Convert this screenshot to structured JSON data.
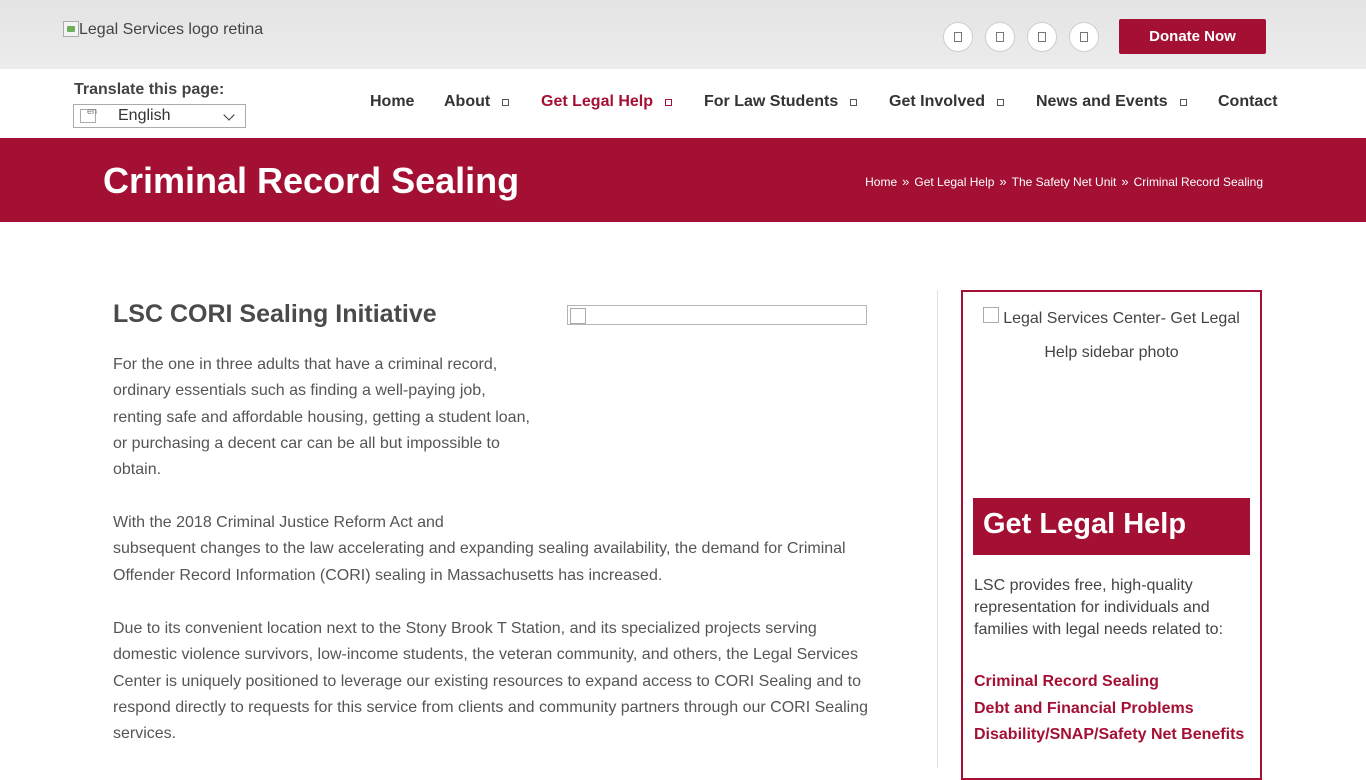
{
  "header": {
    "logo_alt": "Legal Services logo retina",
    "social_icons": [
      "facebook-icon",
      "twitter-icon",
      "instagram-icon",
      "youtube-icon"
    ],
    "donate_label": "Donate Now"
  },
  "translate": {
    "label": "Translate this page:",
    "flag_code": "en",
    "selected": "English"
  },
  "nav": {
    "items": [
      {
        "label": "Home",
        "has_dropdown": false,
        "active": false
      },
      {
        "label": "About",
        "has_dropdown": true,
        "active": false
      },
      {
        "label": "Get Legal Help",
        "has_dropdown": true,
        "active": true
      },
      {
        "label": "For Law Students",
        "has_dropdown": true,
        "active": false
      },
      {
        "label": "Get Involved",
        "has_dropdown": true,
        "active": false
      },
      {
        "label": "News and Events",
        "has_dropdown": true,
        "active": false
      },
      {
        "label": "Contact",
        "has_dropdown": false,
        "active": false
      }
    ]
  },
  "banner": {
    "title": "Criminal Record Sealing",
    "breadcrumb": [
      "Home",
      "Get Legal Help",
      "The Safety Net Unit",
      "Criminal Record Sealing"
    ],
    "separator": "»"
  },
  "main": {
    "heading": "LSC CORI Sealing Initiative",
    "paragraph1": "For the one in three adults that have a criminal record, ordinary essentials such as finding a well-paying job, renting safe and affordable housing, getting a student loan, or purchasing a decent car can be all but impossible to obtain.",
    "paragraph2_line1": "With the 2018 Criminal Justice Reform Act  and",
    "paragraph2_rest": "subsequent changes to the law accelerating and expanding sealing availability, the demand for Criminal Offender Record Information (CORI) sealing in Massachusetts has increased.",
    "paragraph3": "Due to its convenient location next to the Stony Brook T Station, and its specialized projects serving domestic violence survivors, low-income students, the veteran community, and others, the Legal Services Center is uniquely positioned to leverage our existing resources to expand access to CORI Sealing and to respond directly to requests for this service from clients and community partners through our CORI Sealing services."
  },
  "sidebar": {
    "photo_alt": "Legal Services Center- Get Legal Help sidebar photo",
    "heading": "Get Legal Help",
    "description": "LSC provides free, high-quality representation for individuals and families with legal needs related to:",
    "links": [
      "Criminal Record Sealing",
      "Debt and Financial Problems",
      "Disability/SNAP/Safety Net Benefits"
    ]
  },
  "colors": {
    "brand": "#a41034",
    "text": "#444444"
  }
}
